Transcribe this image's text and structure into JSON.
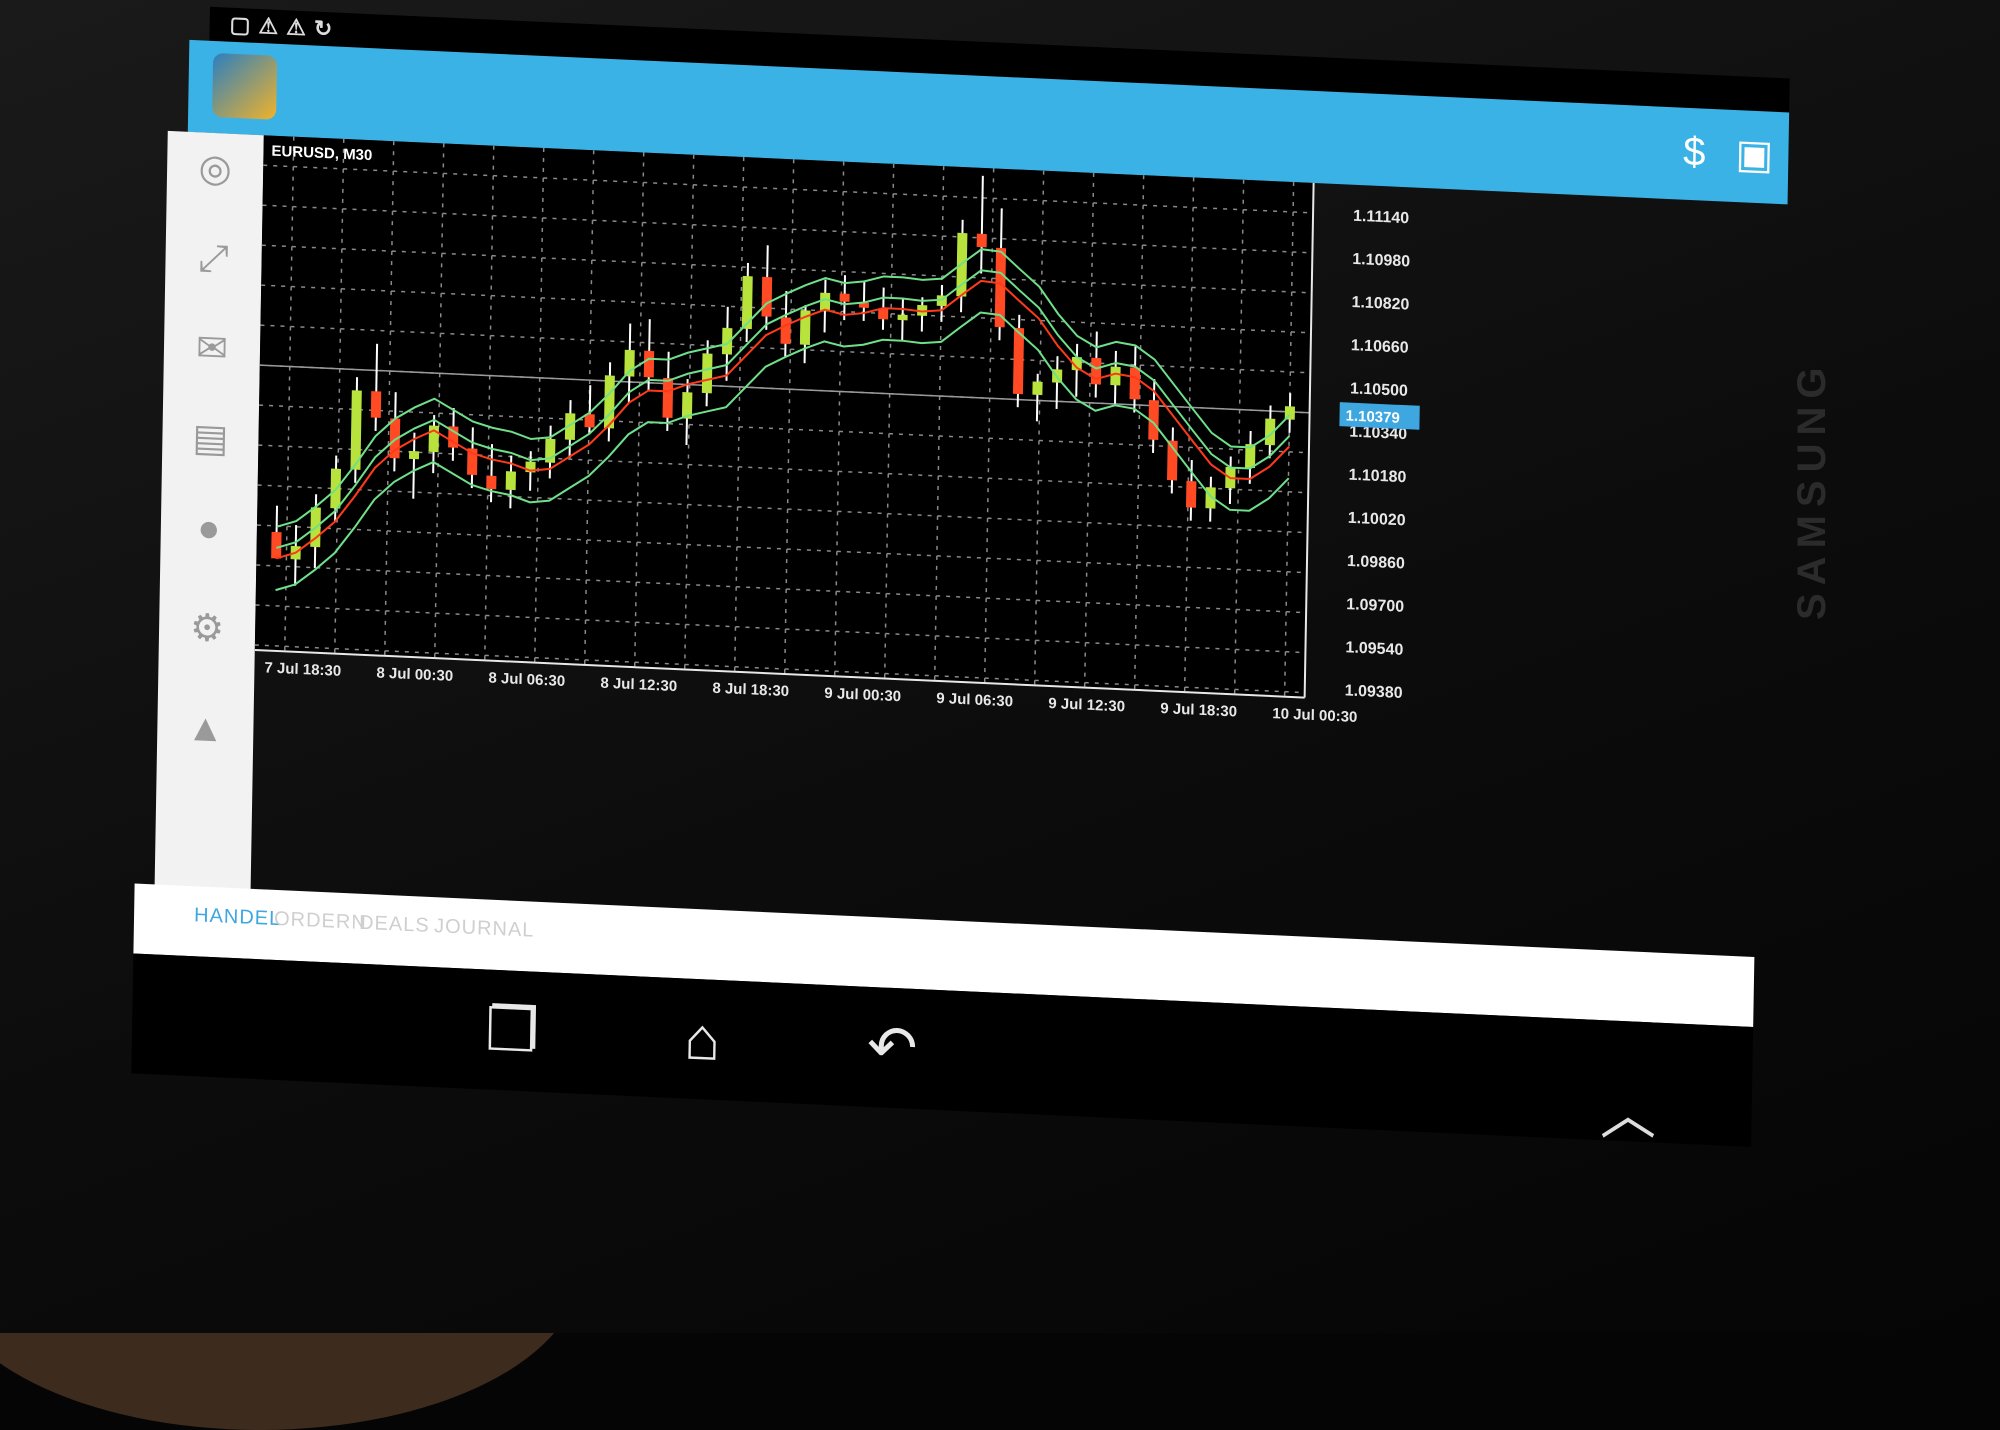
{
  "device": {
    "brand": "SAMSUNG"
  },
  "statusbar": {
    "icons": [
      "notification-icon",
      "warning-icon",
      "warning-icon",
      "sync-icon"
    ]
  },
  "actionbar": {
    "app_icon": "metatrader-app-icon",
    "actions": [
      "currency-exchange-icon",
      "new-order-icon"
    ],
    "color": "#3bb2e6"
  },
  "sidebar": {
    "items": [
      "quotes-icon",
      "chart-tools-icon",
      "mail-icon",
      "news-icon",
      "chat-icon",
      "settings-icon",
      "signals-icon"
    ]
  },
  "tabs": [
    {
      "label": "HANDEL",
      "active": true
    },
    {
      "label": "ORDERN",
      "active": false
    },
    {
      "label": "DEALS",
      "active": false
    },
    {
      "label": "JOURNAL",
      "active": false
    }
  ],
  "navbar": {
    "items": [
      "recent-apps-icon",
      "home-icon",
      "back-icon"
    ]
  },
  "chart_data": {
    "type": "candlestick",
    "title": "EURUSD, M30",
    "current_price": "1.10379",
    "y_ticks": [
      "1.11140",
      "1.10980",
      "1.10820",
      "1.10660",
      "1.10500",
      "1.10340",
      "1.10180",
      "1.10020",
      "1.09860",
      "1.09700",
      "1.09540",
      "1.09380"
    ],
    "x_ticks": [
      "7 Jul 18:30",
      "8 Jul 00:30",
      "8 Jul 06:30",
      "8 Jul 12:30",
      "8 Jul 18:30",
      "9 Jul 00:30",
      "9 Jul 06:30",
      "9 Jul 12:30",
      "9 Jul 18:30",
      "10 Jul 00:30"
    ],
    "ylim": [
      1.093,
      1.1125
    ],
    "grid": true,
    "colors": {
      "up": "#b8e23c",
      "down": "#ff4a24",
      "bands": "#6fe08a",
      "ma": "#ff3a1a",
      "background": "#000000",
      "grid": "#8a8a8a"
    },
    "candles": [
      [
        1.0975,
        1.0985,
        1.0965,
        1.0965
      ],
      [
        1.0965,
        1.0978,
        1.0955,
        1.097
      ],
      [
        1.097,
        1.099,
        1.0962,
        1.0985
      ],
      [
        1.0985,
        1.1005,
        1.098,
        1.1
      ],
      [
        1.1,
        1.1035,
        1.0995,
        1.103
      ],
      [
        1.103,
        1.1048,
        1.1015,
        1.102
      ],
      [
        1.102,
        1.103,
        1.1,
        1.1005
      ],
      [
        1.1005,
        1.1015,
        1.099,
        1.1008
      ],
      [
        1.1008,
        1.1022,
        1.1,
        1.1018
      ],
      [
        1.1018,
        1.1025,
        1.1005,
        1.101
      ],
      [
        1.101,
        1.1018,
        1.0995,
        1.1
      ],
      [
        1.1,
        1.1012,
        1.099,
        1.0995
      ],
      [
        1.0995,
        1.1008,
        1.0988,
        1.1002
      ],
      [
        1.1002,
        1.101,
        1.0995,
        1.1006
      ],
      [
        1.1006,
        1.102,
        1.1,
        1.1015
      ],
      [
        1.1015,
        1.103,
        1.1008,
        1.1025
      ],
      [
        1.1025,
        1.1036,
        1.1018,
        1.102
      ],
      [
        1.102,
        1.1045,
        1.1015,
        1.104
      ],
      [
        1.104,
        1.106,
        1.103,
        1.105
      ],
      [
        1.105,
        1.1062,
        1.1035,
        1.104
      ],
      [
        1.104,
        1.105,
        1.102,
        1.1025
      ],
      [
        1.1025,
        1.104,
        1.1015,
        1.1035
      ],
      [
        1.1035,
        1.1055,
        1.103,
        1.105
      ],
      [
        1.105,
        1.1068,
        1.104,
        1.106
      ],
      [
        1.106,
        1.1085,
        1.1055,
        1.108
      ],
      [
        1.108,
        1.1092,
        1.106,
        1.1065
      ],
      [
        1.1065,
        1.1075,
        1.105,
        1.1055
      ],
      [
        1.1055,
        1.107,
        1.1048,
        1.1068
      ],
      [
        1.1068,
        1.108,
        1.106,
        1.1075
      ],
      [
        1.1075,
        1.1082,
        1.1065,
        1.1072
      ],
      [
        1.1072,
        1.108,
        1.1065,
        1.107
      ],
      [
        1.107,
        1.1078,
        1.1062,
        1.1066
      ],
      [
        1.1066,
        1.1074,
        1.1058,
        1.1068
      ],
      [
        1.1068,
        1.1075,
        1.1062,
        1.1072
      ],
      [
        1.1072,
        1.108,
        1.1066,
        1.1076
      ],
      [
        1.1076,
        1.1105,
        1.107,
        1.11
      ],
      [
        1.11,
        1.1122,
        1.1085,
        1.1095
      ],
      [
        1.1095,
        1.111,
        1.106,
        1.1065
      ],
      [
        1.1065,
        1.107,
        1.1035,
        1.104
      ],
      [
        1.104,
        1.1048,
        1.103,
        1.1045
      ],
      [
        1.1045,
        1.1055,
        1.1035,
        1.105
      ],
      [
        1.105,
        1.106,
        1.104,
        1.1055
      ],
      [
        1.1055,
        1.1065,
        1.104,
        1.1045
      ],
      [
        1.1045,
        1.1058,
        1.1038,
        1.1052
      ],
      [
        1.1052,
        1.106,
        1.1035,
        1.104
      ],
      [
        1.104,
        1.1048,
        1.102,
        1.1025
      ],
      [
        1.1025,
        1.103,
        1.1005,
        1.101
      ],
      [
        1.101,
        1.1018,
        1.0995,
        1.1
      ],
      [
        1.1,
        1.1012,
        1.0995,
        1.1008
      ],
      [
        1.1008,
        1.102,
        1.1002,
        1.1016
      ],
      [
        1.1016,
        1.103,
        1.101,
        1.1025
      ],
      [
        1.1025,
        1.104,
        1.102,
        1.1035
      ],
      [
        1.1035,
        1.1045,
        1.103,
        1.104
      ]
    ]
  }
}
